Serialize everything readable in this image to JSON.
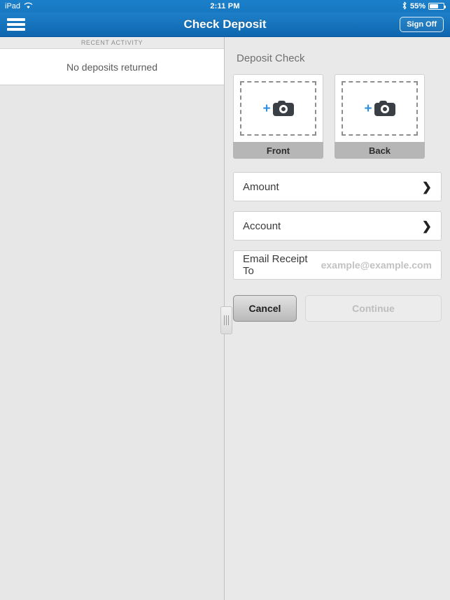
{
  "status_bar": {
    "device": "iPad",
    "wifi_icon": "wifi-icon",
    "time": "2:11 PM",
    "bluetooth_icon": "bluetooth-icon",
    "battery_percent": "55%",
    "battery_icon": "battery-icon"
  },
  "nav": {
    "menu_icon": "hamburger-menu-icon",
    "title": "Check Deposit",
    "sign_off_label": "Sign Off"
  },
  "sidebar": {
    "header": "RECENT ACTIVITY",
    "empty_message": "No deposits returned"
  },
  "main": {
    "section_title": "Deposit Check",
    "captures": [
      {
        "label": "Front",
        "plus_icon": "plus-icon",
        "camera_icon": "camera-icon"
      },
      {
        "label": "Back",
        "plus_icon": "plus-icon",
        "camera_icon": "camera-icon"
      }
    ],
    "fields": [
      {
        "label": "Amount",
        "chevron": "❯"
      },
      {
        "label": "Account",
        "chevron": "❯"
      }
    ],
    "email_field": {
      "label": "Email Receipt To",
      "placeholder": "example@example.com",
      "value": ""
    },
    "buttons": {
      "cancel_label": "Cancel",
      "continue_label": "Continue",
      "continue_enabled": false
    }
  },
  "divider": {
    "handle_icon": "drag-handle-icon"
  },
  "colors": {
    "brand_blue": "#1878c2",
    "accent_blue": "#2f8fe0",
    "panel_gray": "#e9e9e9",
    "label_gray": "#b6b6b6"
  }
}
